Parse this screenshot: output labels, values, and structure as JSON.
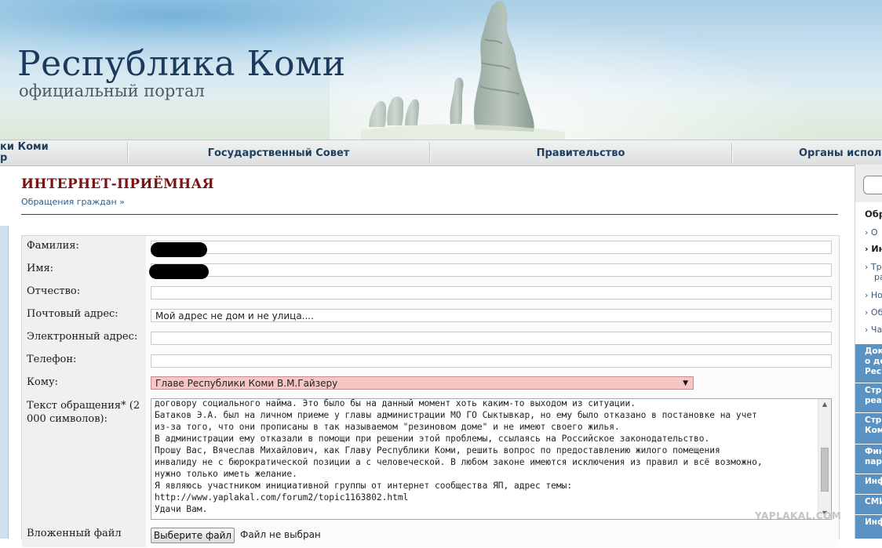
{
  "header": {
    "title": "Республика Коми",
    "subtitle": "официальный портал"
  },
  "nav": {
    "left_partial_line1": "ки Коми",
    "left_partial_line2": "р",
    "items": [
      "Государственный Совет",
      "Правительство",
      "Органы исполни"
    ]
  },
  "page": {
    "title": "ИНТЕРНЕТ-ПРИЁМНАЯ",
    "breadcrumb": "Обращения граждан »"
  },
  "form": {
    "surname_label": "Фамилия:",
    "name_label": "Имя:",
    "patronymic_label": "Отчество:",
    "postal_label": "Почтовый адрес:",
    "postal_value": "Мой адрес не дом и не улица....",
    "email_label": "Электронный адрес:",
    "phone_label": "Телефон:",
    "to_label": "Кому:",
    "to_value": "Главе Республики Коми В.М.Гайзеру",
    "text_label": "Текст обращения* (2 000 символов):",
    "text_value": "договору социального найма. Это было бы на данный момент хоть каким-то выходом из ситуации.\nБатаков Э.А. был на личном приеме у главы администрации МО ГО Сыктывкар, но ему было отказано в постановке на учет\nиз-за того, что они прописаны в так называемом \"резиновом доме\" и не имеют своего жилья.\nВ администрации ему отказали в помощи при решении этой проблемы, ссылаясь на Российское законодательство.\nПрошу Вас, Вячеслав Михайлович, как Главу Республики Коми, решить вопрос по предоставлению жилого помещения\nинвалиду не с бюрократической позиции а с человеческой. В любом законе имеются исключения из правил и всё возможно,\nнужно только иметь желание.\nЯ являюсь участником инициативной группы от интернет сообщества ЯП, адрес темы:\nhttp://www.yaplakal.com/forum2/topic1163802.html\nУдачи Вам.",
    "file_label": "Вложенный файл",
    "file_button": "Выберите файл",
    "file_status": "Файл не выбран"
  },
  "sidebar": {
    "heading": "Обр",
    "links": [
      "О",
      "Ин",
      "Тр",
      "ра",
      "Но",
      "Об",
      "Ча"
    ],
    "blocks": [
      [
        "Док",
        "о де",
        "Рес"
      ],
      [
        "Стр",
        "реа"
      ],
      [
        "Стр",
        "Ком"
      ],
      [
        "Фин",
        "пар"
      ],
      [
        "Инф"
      ],
      [
        "СМИ"
      ],
      [
        "Инф"
      ]
    ]
  },
  "watermark": "YAPLAKAL.COM"
}
